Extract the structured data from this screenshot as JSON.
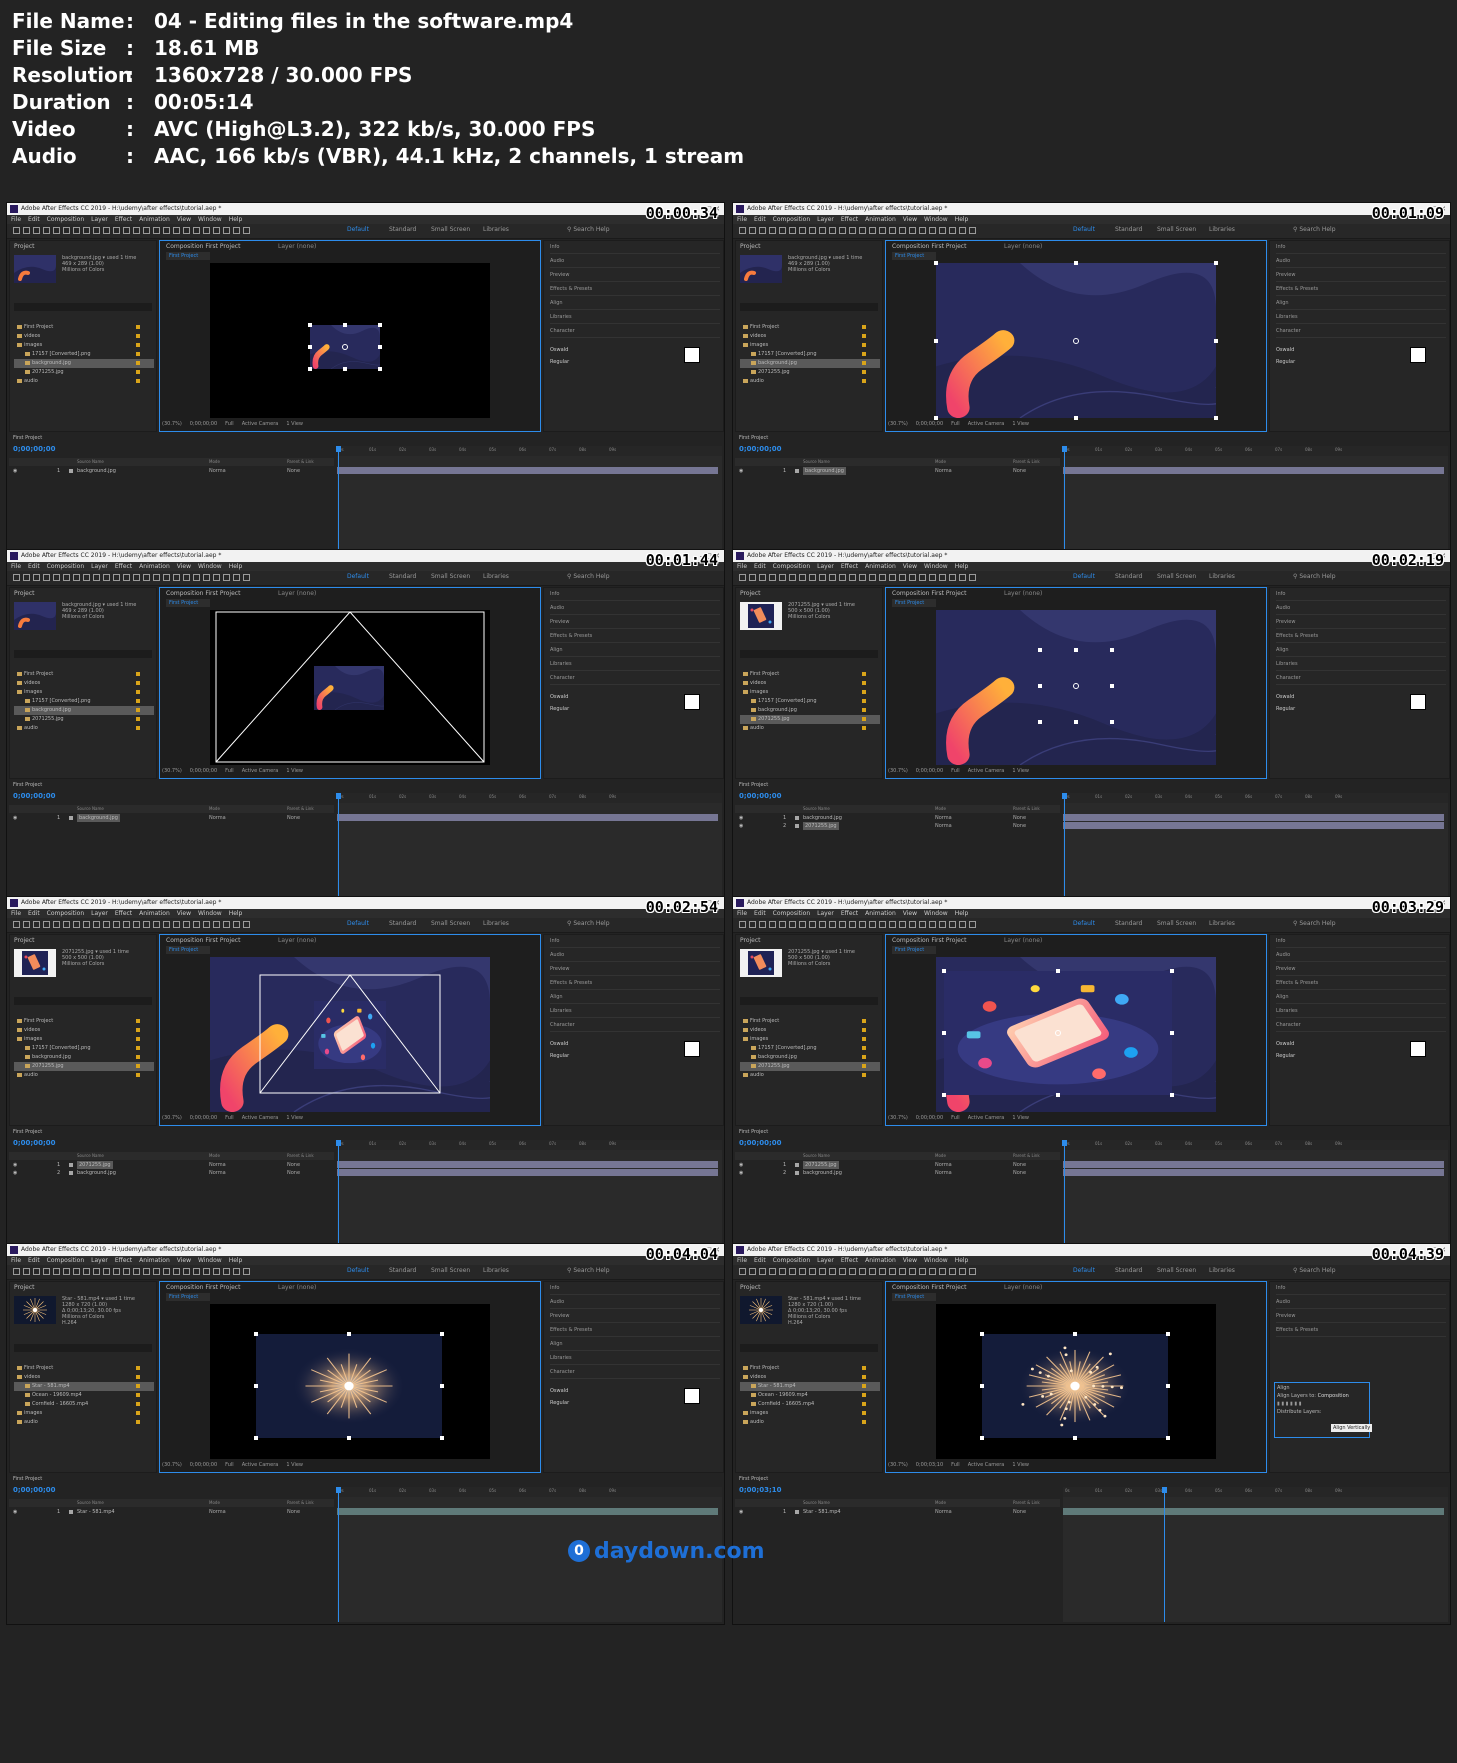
{
  "file_info": [
    {
      "key": "File Name",
      "sep": ":",
      "value": "04 - Editing files in the software.mp4"
    },
    {
      "key": "File Size",
      "sep": ":",
      "value": "18.61 MB"
    },
    {
      "key": "Resolution",
      "sep": ":",
      "value": "1360x728 / 30.000 FPS"
    },
    {
      "key": "Duration",
      "sep": ":",
      "value": "00:05:14"
    },
    {
      "key": "Video",
      "sep": ":",
      "value": "AVC (High@L3.2), 322 kb/s, 30.000 FPS"
    },
    {
      "key": "Audio",
      "sep": ":",
      "value": "AAC, 166 kb/s (VBR), 44.1 kHz, 2 channels, 1 stream"
    }
  ],
  "app": {
    "title": "Adobe After Effects CC 2019 - H:\\udemy\\after effects\\tutorial.aep *",
    "menu": [
      "File",
      "Edit",
      "Composition",
      "Layer",
      "Effect",
      "Animation",
      "View",
      "Window",
      "Help"
    ],
    "workspaces": [
      "Default",
      "Standard",
      "Small Screen",
      "Libraries"
    ],
    "search_help": "Search Help",
    "project_label": "Project",
    "comp_tab": "Composition First Project",
    "layer_tab": "Layer (none)",
    "comp_name": "First Project",
    "zoom": "(30.7%)",
    "quality": "Full",
    "camera": "Active Camera",
    "view": "1 View",
    "right_panels": [
      "Info",
      "Audio",
      "Preview",
      "Effects & Presets",
      "Align",
      "Libraries",
      "Character"
    ],
    "font": "Oswald",
    "font_style": "Regular",
    "timeline_title": "First Project",
    "column_source": "Source Name",
    "column_mode": "Mode",
    "column_parent": "Parent & Link",
    "mode_value": "Norma",
    "parent_value": "None",
    "ruler": [
      "0s",
      "01s",
      "02s",
      "03s",
      "04s",
      "05s",
      "06s",
      "07s",
      "08s",
      "09s"
    ]
  },
  "frames": [
    {
      "timestamp": "00:00:34",
      "timecode": "0;00;00;00",
      "preview": "background.jpg",
      "preview_info": "469 x 289 (1.00)\nMillions of Colors",
      "used": "used 1 time",
      "items": [
        {
          "name": "First Project",
          "depth": 0,
          "sel": false
        },
        {
          "name": "videos",
          "depth": 0,
          "sel": false
        },
        {
          "name": "images",
          "depth": 0,
          "sel": false
        },
        {
          "name": "17157 [Converted].png",
          "depth": 1,
          "sel": false
        },
        {
          "name": "background.jpg",
          "depth": 1,
          "sel": true
        },
        {
          "name": "2071255.jpg",
          "depth": 1,
          "sel": false
        },
        {
          "name": "audio",
          "depth": 0,
          "sel": false
        }
      ],
      "layers": [
        {
          "num": "1",
          "name": "background.jpg",
          "sel": false
        }
      ]
    },
    {
      "timestamp": "00:01:09",
      "timecode": "0;00;00;00",
      "preview": "background.jpg",
      "preview_info": "469 x 289 (1.00)\nMillions of Colors",
      "used": "used 1 time",
      "items": [
        {
          "name": "First Project",
          "depth": 0,
          "sel": false
        },
        {
          "name": "videos",
          "depth": 0,
          "sel": false
        },
        {
          "name": "images",
          "depth": 0,
          "sel": false
        },
        {
          "name": "17157 [Converted].png",
          "depth": 1,
          "sel": false
        },
        {
          "name": "background.jpg",
          "depth": 1,
          "sel": true
        },
        {
          "name": "2071255.jpg",
          "depth": 1,
          "sel": false
        },
        {
          "name": "audio",
          "depth": 0,
          "sel": false
        }
      ],
      "layers": [
        {
          "num": "1",
          "name": "background.jpg",
          "sel": true
        }
      ]
    },
    {
      "timestamp": "00:01:44",
      "timecode": "0;00;00;00",
      "preview": "background.jpg",
      "preview_info": "469 x 289 (1.00)\nMillions of Colors",
      "used": "used 1 time",
      "items": [
        {
          "name": "First Project",
          "depth": 0,
          "sel": false
        },
        {
          "name": "videos",
          "depth": 0,
          "sel": false
        },
        {
          "name": "images",
          "depth": 0,
          "sel": false
        },
        {
          "name": "17157 [Converted].png",
          "depth": 1,
          "sel": false
        },
        {
          "name": "background.jpg",
          "depth": 1,
          "sel": true
        },
        {
          "name": "2071255.jpg",
          "depth": 1,
          "sel": false
        },
        {
          "name": "audio",
          "depth": 0,
          "sel": false
        }
      ],
      "layers": [
        {
          "num": "1",
          "name": "background.jpg",
          "sel": true
        }
      ]
    },
    {
      "timestamp": "00:02:19",
      "timecode": "0;00;00;00",
      "preview": "2071255.jpg",
      "preview_info": "500 x 500 (1.00)\nMillions of Colors",
      "used": "used 1 time",
      "items": [
        {
          "name": "First Project",
          "depth": 0,
          "sel": false
        },
        {
          "name": "videos",
          "depth": 0,
          "sel": false
        },
        {
          "name": "images",
          "depth": 0,
          "sel": false
        },
        {
          "name": "17157 [Converted].png",
          "depth": 1,
          "sel": false
        },
        {
          "name": "background.jpg",
          "depth": 1,
          "sel": false
        },
        {
          "name": "2071255.jpg",
          "depth": 1,
          "sel": true
        },
        {
          "name": "audio",
          "depth": 0,
          "sel": false
        }
      ],
      "layers": [
        {
          "num": "1",
          "name": "background.jpg",
          "sel": false
        },
        {
          "num": "2",
          "name": "2071255.jpg",
          "sel": true
        }
      ]
    },
    {
      "timestamp": "00:02:54",
      "timecode": "0;00;00;00",
      "preview": "2071255.jpg",
      "preview_info": "500 x 500 (1.00)\nMillions of Colors",
      "used": "used 1 time",
      "items": [
        {
          "name": "First Project",
          "depth": 0,
          "sel": false
        },
        {
          "name": "videos",
          "depth": 0,
          "sel": false
        },
        {
          "name": "images",
          "depth": 0,
          "sel": false
        },
        {
          "name": "17157 [Converted].png",
          "depth": 1,
          "sel": false
        },
        {
          "name": "background.jpg",
          "depth": 1,
          "sel": false
        },
        {
          "name": "2071255.jpg",
          "depth": 1,
          "sel": true
        },
        {
          "name": "audio",
          "depth": 0,
          "sel": false
        }
      ],
      "layers": [
        {
          "num": "1",
          "name": "2071255.jpg",
          "sel": true
        },
        {
          "num": "2",
          "name": "background.jpg",
          "sel": false
        }
      ]
    },
    {
      "timestamp": "00:03:29",
      "timecode": "0;00;00;00",
      "preview": "2071255.jpg",
      "preview_info": "500 x 500 (1.00)\nMillions of Colors",
      "used": "used 1 time",
      "items": [
        {
          "name": "First Project",
          "depth": 0,
          "sel": false
        },
        {
          "name": "videos",
          "depth": 0,
          "sel": false
        },
        {
          "name": "images",
          "depth": 0,
          "sel": false
        },
        {
          "name": "17157 [Converted].png",
          "depth": 1,
          "sel": false
        },
        {
          "name": "background.jpg",
          "depth": 1,
          "sel": false
        },
        {
          "name": "2071255.jpg",
          "depth": 1,
          "sel": true
        },
        {
          "name": "audio",
          "depth": 0,
          "sel": false
        }
      ],
      "layers": [
        {
          "num": "1",
          "name": "2071255.jpg",
          "sel": true
        },
        {
          "num": "2",
          "name": "background.jpg",
          "sel": false
        }
      ]
    },
    {
      "timestamp": "00:04:04",
      "timecode": "0;00;00;00",
      "preview": "Star - 581.mp4",
      "preview_info": "1280 x 720 (1.00)\nΔ 0;00;13;20, 30.00 fps\nMillions of Colors\nH.264",
      "used": "used 1 time",
      "items": [
        {
          "name": "First Project",
          "depth": 0,
          "sel": false
        },
        {
          "name": "videos",
          "depth": 0,
          "sel": false
        },
        {
          "name": "Star - 581.mp4",
          "depth": 1,
          "sel": true
        },
        {
          "name": "Ocean - 19609.mp4",
          "depth": 1,
          "sel": false
        },
        {
          "name": "Cornfield - 16605.mp4",
          "depth": 1,
          "sel": false
        },
        {
          "name": "images",
          "depth": 0,
          "sel": false
        },
        {
          "name": "audio",
          "depth": 0,
          "sel": false
        }
      ],
      "layers": [
        {
          "num": "1",
          "name": "Star - 581.mp4",
          "sel": false
        }
      ]
    },
    {
      "timestamp": "00:04:39",
      "timecode": "0;00;03;10",
      "preview": "Star - 581.mp4",
      "preview_info": "1280 x 720 (1.00)\nΔ 0;00;13;20, 30.00 fps\nMillions of Colors\nH.264",
      "used": "used 1 time",
      "items": [
        {
          "name": "First Project",
          "depth": 0,
          "sel": false
        },
        {
          "name": "videos",
          "depth": 0,
          "sel": false
        },
        {
          "name": "Star - 581.mp4",
          "depth": 1,
          "sel": true
        },
        {
          "name": "Ocean - 19609.mp4",
          "depth": 1,
          "sel": false
        },
        {
          "name": "Cornfield - 16605.mp4",
          "depth": 1,
          "sel": false
        },
        {
          "name": "images",
          "depth": 0,
          "sel": false
        },
        {
          "name": "audio",
          "depth": 0,
          "sel": false
        }
      ],
      "layers": [
        {
          "num": "1",
          "name": "Star - 581.mp4",
          "sel": false
        }
      ],
      "align_panel": {
        "title": "Align",
        "align_to_label": "Align Layers to:",
        "align_to_value": "Composition",
        "distribute": "Distribute Layers:",
        "tooltip": "Align Vertically"
      }
    }
  ],
  "watermark": "daydown.com",
  "watermark_logo": "0"
}
